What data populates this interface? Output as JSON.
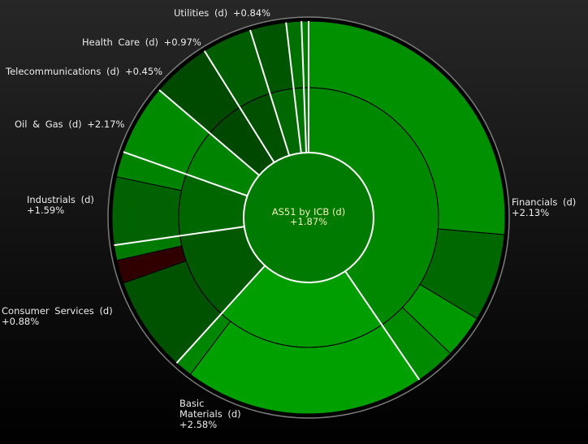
{
  "chart_data": {
    "type": "sunburst",
    "title": "AS51 by ICB (d)",
    "title_value": "+1.87%",
    "center_color": "#007a00",
    "sectors": [
      {
        "name": "Financials (d)",
        "value": "+2.13%",
        "weight": 145.7,
        "color": "#008800",
        "children": [
          {
            "weight": 95,
            "color": "#009000"
          },
          {
            "weight": 26,
            "color": "#006800"
          },
          {
            "weight": 12.8,
            "color": "#009800"
          },
          {
            "weight": 11.9,
            "color": "#008a00"
          }
        ]
      },
      {
        "name": "Basic Materials (d)",
        "value": "+2.58%",
        "weight": 76.5,
        "color": "#009e00",
        "children": [
          {
            "weight": 71.3,
            "color": "#00a000"
          },
          {
            "weight": 5.2,
            "color": "#008600"
          }
        ]
      },
      {
        "name": "Consumer Services (d)",
        "value": "+0.88%",
        "weight": 39.7,
        "color": "#005800",
        "children": [
          {
            "weight": 28.3,
            "color": "#005200"
          },
          {
            "weight": 6.9,
            "color": "#300000"
          },
          {
            "weight": 4.5,
            "color": "#007a00"
          }
        ]
      },
      {
        "name": "Industrials (d)",
        "value": "+1.59%",
        "weight": 27.6,
        "color": "#006600",
        "children": [
          {
            "weight": 20.1,
            "color": "#006200"
          },
          {
            "weight": 7.5,
            "color": "#008400"
          }
        ]
      },
      {
        "name": "Oil & Gas (d)",
        "value": "+2.17%",
        "weight": 21,
        "color": "#008400",
        "children": [
          {
            "weight": 21,
            "color": "#008a00"
          }
        ]
      },
      {
        "name": "Telecommunications (d)",
        "value": "+0.45%",
        "weight": 17.5,
        "color": "#004800",
        "children": [
          {
            "weight": 17.5,
            "color": "#004a00"
          }
        ]
      },
      {
        "name": "Health Care (d)",
        "value": "+0.97%",
        "weight": 14.7,
        "color": "#005000",
        "children": [
          {
            "weight": 14.7,
            "color": "#005e00"
          }
        ]
      },
      {
        "name": "Utilities (d)",
        "value": "+0.84%",
        "weight": 10.7,
        "color": "#006800",
        "children": [
          {
            "weight": 10.7,
            "color": "#005600"
          }
        ]
      },
      {
        "name": "",
        "value": "",
        "weight": 4.5,
        "color": "#007400",
        "children": [
          {
            "weight": 4.5,
            "color": "#007000"
          }
        ]
      },
      {
        "name": "",
        "value": "",
        "weight": 2.1,
        "color": "#007a00",
        "children": [
          {
            "weight": 2.1,
            "color": "#008000"
          }
        ]
      }
    ]
  }
}
